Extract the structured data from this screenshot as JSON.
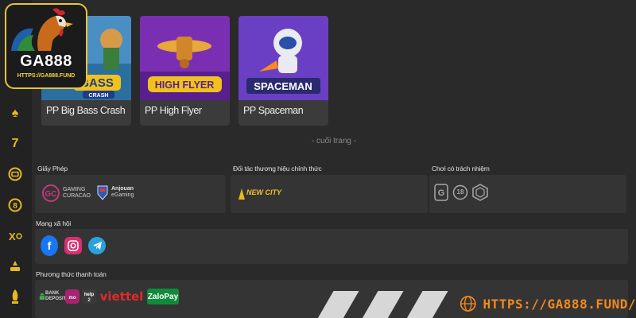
{
  "logo": {
    "brand": "GA888",
    "url": "HTTPS://GA888.FUND"
  },
  "sidebar": {
    "icons": [
      "spade-icon",
      "seven-icon",
      "slot-icon",
      "coin-icon",
      "sport-icon",
      "lottery-icon",
      "rocket-icon"
    ]
  },
  "games": [
    {
      "name": "PP Big Bass Crash",
      "thumb_text": "BASS",
      "thumb_sub": "CRASH"
    },
    {
      "name": "PP High Flyer",
      "thumb_text": "HIGH FLYER"
    },
    {
      "name": "PP Spaceman",
      "thumb_text": "SPACEMAN"
    }
  ],
  "end_label": "- cuối trang -",
  "license": {
    "title": "Giấy Phép",
    "gc_line1": "GAMING",
    "gc_line2": "CURACAO",
    "aj_line1": "Anjouan",
    "aj_line2": "eGaming"
  },
  "partners": {
    "title": "Đối tác thương hiệu chính thức",
    "logo_text": "NEW CITY"
  },
  "responsible": {
    "title": "Chơi có trách nhiệm",
    "age": "18"
  },
  "social": {
    "title": "Mạng xã hội"
  },
  "payment": {
    "title": "Phương thức thanh toán",
    "bank": "BANK DEPOSIT",
    "viettel": "viettel",
    "zalo": "ZaloPay"
  },
  "promo": {
    "text": "HTTPS://GA888.FUND/"
  },
  "colors": {
    "accent": "#e8b920",
    "promo": "#f28a1c",
    "panel": "#343434",
    "background": "#2a2a2a"
  }
}
